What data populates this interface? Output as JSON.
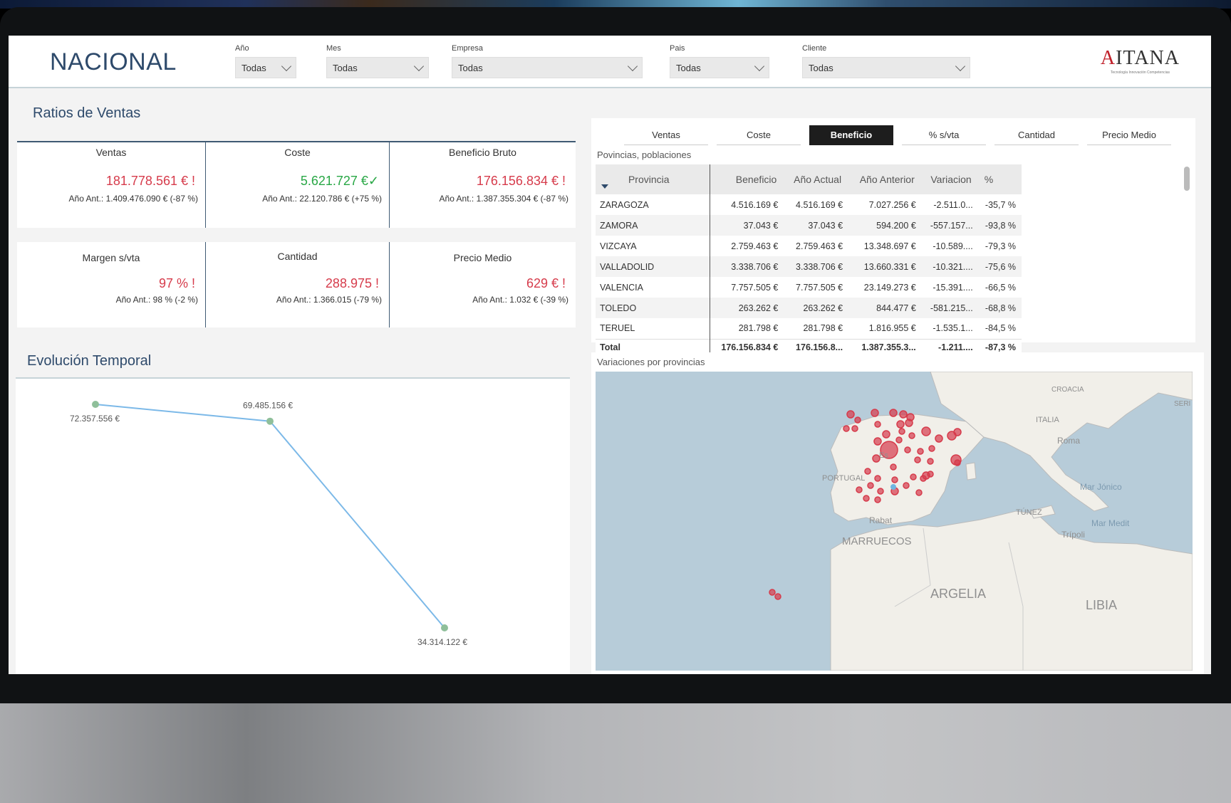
{
  "header": {
    "title": "NACIONAL",
    "filters": [
      {
        "label": "Año",
        "value": "Todas"
      },
      {
        "label": "Mes",
        "value": "Todas"
      },
      {
        "label": "Empresa",
        "value": "Todas"
      },
      {
        "label": "Pais",
        "value": "Todas"
      },
      {
        "label": "Cliente",
        "value": "Todas"
      }
    ],
    "logo_text": "AITANA",
    "logo_sub": "Tecnología Innovación Competencias"
  },
  "ratios": {
    "title": "Ratios de Ventas",
    "row1": [
      {
        "title": "Ventas",
        "value": "181.778.561 € !",
        "prev": "Año Ant.: 1.409.476.090 € (-87 %)",
        "status": "bad"
      },
      {
        "title": "Coste",
        "value": "5.621.727 €✓",
        "prev": "Año Ant.: 22.120.786 € (+75 %)",
        "status": "good"
      },
      {
        "title": "Beneficio Bruto",
        "value": "176.156.834 € !",
        "prev": "Año Ant.: 1.387.355.304 € (-87 %)",
        "status": "bad"
      }
    ],
    "row2": [
      {
        "title": "Margen s/vta",
        "value": "97 % !",
        "prev": "Año Ant.: 98 % (-2 %)",
        "status": "bad"
      },
      {
        "title": "Cantidad",
        "value": "288.975 !",
        "prev": "Año Ant.: 1.366.015 (-79 %)",
        "status": "bad"
      },
      {
        "title": "Precio Medio",
        "value": "629 € !",
        "prev": "Año Ant.: 1.032 € (-39 %)",
        "status": "bad"
      }
    ]
  },
  "evolucion": {
    "title": "Evolución Temporal"
  },
  "chart_data": {
    "type": "line",
    "title": "Evolución Temporal",
    "series": [
      {
        "values": [
          72357556,
          69485156,
          34314122
        ]
      }
    ],
    "labels": [
      "72.357.556 €",
      "69.485.156 €",
      "34.314.122 €"
    ],
    "color": "#7cb9e8",
    "marker_color": "#8fbf9a"
  },
  "tabs": [
    "Ventas",
    "Coste",
    "Beneficio",
    "% s/vta",
    "Cantidad",
    "Precio Medio"
  ],
  "active_tab": "Beneficio",
  "table": {
    "title": "Povincias, poblaciones",
    "columns": [
      "Provincia",
      "Beneficio",
      "Año Actual",
      "Año Anterior",
      "Variacion",
      "%"
    ],
    "rows": [
      [
        "ZARAGOZA",
        "4.516.169 €",
        "4.516.169 €",
        "7.027.256 €",
        "-2.511.0...",
        "-35,7 %"
      ],
      [
        "ZAMORA",
        "37.043 €",
        "37.043 €",
        "594.200 €",
        "-557.157...",
        "-93,8 %"
      ],
      [
        "VIZCAYA",
        "2.759.463 €",
        "2.759.463 €",
        "13.348.697 €",
        "-10.589....",
        "-79,3 %"
      ],
      [
        "VALLADOLID",
        "3.338.706 €",
        "3.338.706 €",
        "13.660.331 €",
        "-10.321....",
        "-75,6 %"
      ],
      [
        "VALENCIA",
        "7.757.505 €",
        "7.757.505 €",
        "23.149.273 €",
        "-15.391....",
        "-66,5 %"
      ],
      [
        "TOLEDO",
        "263.262 €",
        "263.262 €",
        "844.477 €",
        "-581.215...",
        "-68,8 %"
      ],
      [
        "TERUEL",
        "281.798 €",
        "281.798 €",
        "1.816.955 €",
        "-1.535.1...",
        "-84,5 %"
      ]
    ],
    "total": [
      "Total",
      "176.156.834 €",
      "176.156.8...",
      "1.387.355.3...",
      "-1.211....",
      "-87,3 %"
    ]
  },
  "map": {
    "title": "Variaciones por provincias",
    "labels": [
      "CROACIA",
      "SERI",
      "ITALIA",
      "Roma",
      "PORTUGAL",
      "Mar Jónico",
      "TÚNEZ",
      "Rabat",
      "Mar Medit",
      "Trípoli",
      "MARRUECOS",
      "ARGELIA",
      "LIBIA",
      "Es"
    ],
    "bubble_color": "#d63b4b"
  }
}
